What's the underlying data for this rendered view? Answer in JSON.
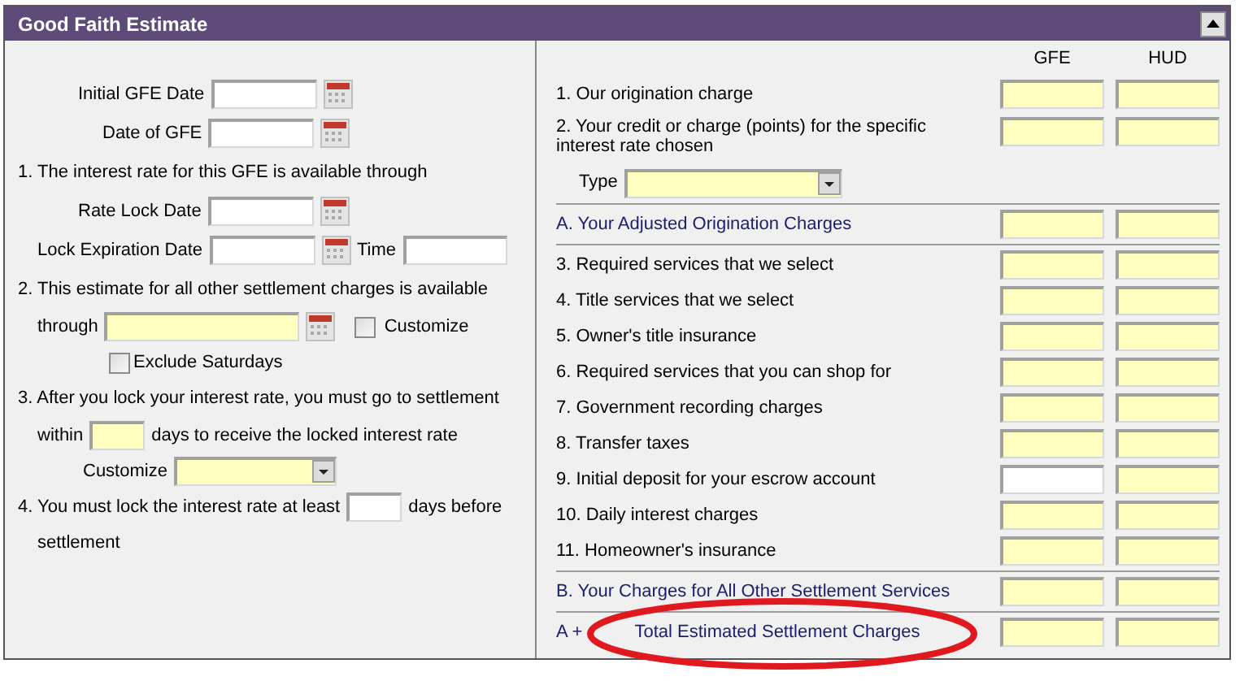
{
  "window": {
    "title": "Good Faith Estimate"
  },
  "left": {
    "initial_gfe_date": {
      "label": "Initial GFE Date",
      "highlighted": false
    },
    "date_of_gfe": {
      "label": "Date of GFE",
      "highlighted": false
    },
    "section_1": "1. The interest rate for this GFE is available through",
    "rate_lock_date": {
      "label": "Rate Lock Date",
      "highlighted": false
    },
    "lock_expiration_date": {
      "label": "Lock Expiration Date",
      "highlighted": false
    },
    "time": {
      "label": "Time",
      "highlighted": false
    },
    "section_2": "2. This estimate for all other settlement charges is available",
    "through": {
      "label": "through",
      "highlighted": true
    },
    "customize_checkbox": {
      "label": "Customize",
      "checked": false
    },
    "exclude_saturdays": {
      "label": "Exclude Saturdays",
      "checked": false
    },
    "section_3": "3. After you lock your interest rate, you must go to settlement",
    "within": {
      "label": "within",
      "highlighted": true,
      "suffix": "days to receive the locked interest rate"
    },
    "customize_select": {
      "label": "Customize",
      "highlighted": true
    },
    "section_4": {
      "label": "4. You must lock the interest rate at least",
      "highlighted": false,
      "suffix": "days before",
      "continuation": "settlement"
    }
  },
  "right": {
    "columns": [
      "GFE",
      "HUD"
    ],
    "rows": [
      {
        "kind": "item",
        "label": "1. Our origination charge",
        "gfe_highlighted": true,
        "hud_highlighted": true
      },
      {
        "kind": "item",
        "label": "2. Your credit or charge (points) for the specific interest rate chosen",
        "gfe_highlighted": true,
        "hud_highlighted": true
      },
      {
        "kind": "select",
        "label": "Type",
        "highlighted": true
      },
      {
        "kind": "subtotal",
        "label": "A. Your Adjusted Origination Charges",
        "gfe_highlighted": true,
        "hud_highlighted": true
      },
      {
        "kind": "item",
        "label": "3. Required services that we select",
        "gfe_highlighted": true,
        "hud_highlighted": true
      },
      {
        "kind": "item",
        "label": "4. Title services that we select",
        "gfe_highlighted": true,
        "hud_highlighted": true
      },
      {
        "kind": "item",
        "label": "5. Owner's title insurance",
        "gfe_highlighted": true,
        "hud_highlighted": true
      },
      {
        "kind": "item",
        "label": "6. Required services that you can shop for",
        "gfe_highlighted": true,
        "hud_highlighted": true
      },
      {
        "kind": "item",
        "label": "7. Government recording charges",
        "gfe_highlighted": true,
        "hud_highlighted": true
      },
      {
        "kind": "item",
        "label": "8. Transfer taxes",
        "gfe_highlighted": true,
        "hud_highlighted": true
      },
      {
        "kind": "item",
        "label": "9. Initial deposit for your escrow account",
        "gfe_highlighted": false,
        "hud_highlighted": true
      },
      {
        "kind": "item",
        "label": "10. Daily interest charges",
        "gfe_highlighted": true,
        "hud_highlighted": true
      },
      {
        "kind": "item",
        "label": "11. Homeowner's insurance",
        "gfe_highlighted": true,
        "hud_highlighted": true
      },
      {
        "kind": "subtotal",
        "label": "B. Your Charges for All Other Settlement Services",
        "gfe_highlighted": true,
        "hud_highlighted": true
      },
      {
        "kind": "total",
        "prefix": "A +",
        "label": "Total Estimated Settlement Charges",
        "gfe_highlighted": true,
        "hud_highlighted": true
      }
    ]
  }
}
